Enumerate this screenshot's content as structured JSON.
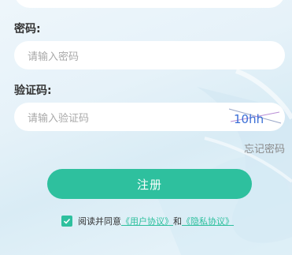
{
  "password": {
    "label": "密码:",
    "placeholder": "请输入密码"
  },
  "captcha": {
    "label": "验证码:",
    "placeholder": "请输入验证码",
    "image_text": "10hh"
  },
  "forgot_password": "忘记密码",
  "register_button": "注册",
  "agreement": {
    "prefix": "阅读并同意",
    "user_agreement": "《用户协议》",
    "and": "和",
    "privacy_agreement": "《隐私协议》"
  },
  "colors": {
    "accent": "#2ec09e",
    "captcha_blue": "#3b6fd6",
    "captcha_purple": "#8e3ccf"
  }
}
